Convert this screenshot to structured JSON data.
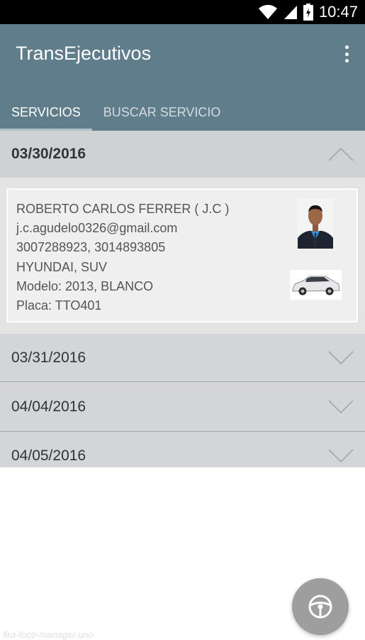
{
  "status_bar": {
    "time": "10:47",
    "icons": [
      "wifi-icon",
      "signal-icon",
      "battery-icon"
    ]
  },
  "app": {
    "title": "TransEjecutivos",
    "overflow_icon": "more-vert-icon",
    "accent_color": "#607d8b"
  },
  "tabs": [
    {
      "label": "SERVICIOS",
      "active": true
    },
    {
      "label": "BUSCAR SERVICIO",
      "active": false
    }
  ],
  "services": [
    {
      "date": "03/30/2016",
      "expanded": true,
      "details": {
        "driver_name": "ROBERTO CARLOS FERRER ( J.C )",
        "email": "j.c.agudelo0326@gmail.com",
        "phones": "3007288923, 3014893805",
        "vehicle": "HYUNDAI, SUV",
        "model": "Modelo: 2013, BLANCO",
        "plate": "Placa: TTO401"
      }
    },
    {
      "date": "03/31/2016",
      "expanded": false
    },
    {
      "date": "04/04/2016",
      "expanded": false
    },
    {
      "date": "04/05/2016",
      "expanded": false
    }
  ],
  "fab": {
    "icon": "steering-wheel-icon"
  },
  "footer": {
    "text": "fira-foco-manager.uno"
  }
}
